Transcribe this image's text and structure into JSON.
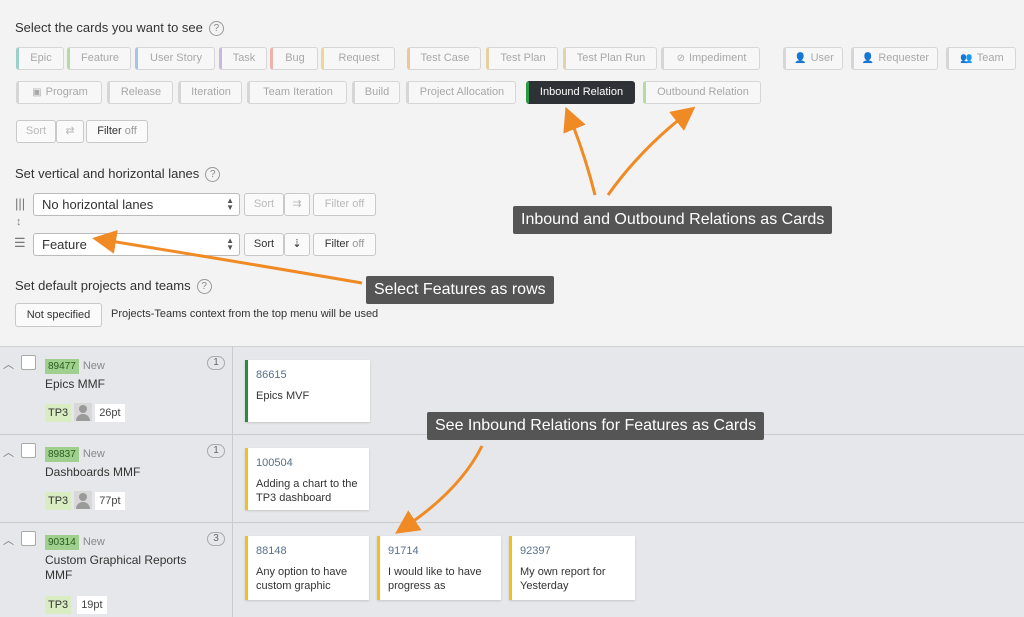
{
  "sections": {
    "cards_heading": "Select the cards you want to see",
    "lanes_heading": "Set vertical and horizontal lanes",
    "projects_heading": "Set default projects and teams",
    "help": "?"
  },
  "card_types_row1": [
    {
      "label": "Epic",
      "color": "#9bd0c8"
    },
    {
      "label": "Feature",
      "color": "#b6d9a7"
    },
    {
      "label": "User Story",
      "color": "#a9c3e6"
    },
    {
      "label": "Task",
      "color": "#c9b7df"
    },
    {
      "label": "Bug",
      "color": "#efb0b0"
    },
    {
      "label": "Request",
      "color": "#f1d49a"
    },
    {
      "label": "Test Case",
      "color": "#f1c59a"
    },
    {
      "label": "Test Plan",
      "color": "#e8d09e"
    },
    {
      "label": "Test Plan Run",
      "color": "#e1d2b3"
    },
    {
      "label": "Impediment",
      "color": "#d6d6d6"
    },
    {
      "label": "User",
      "color": "#d6d6d6"
    },
    {
      "label": "Requester",
      "color": "#d6d6d6"
    },
    {
      "label": "Team",
      "color": "#d6d6d6"
    }
  ],
  "card_types_row2": [
    {
      "label": "Program",
      "color": "#d6d6d6"
    },
    {
      "label": "Release",
      "color": "#d6d6d6"
    },
    {
      "label": "Iteration",
      "color": "#d6d6d6"
    },
    {
      "label": "Team Iteration",
      "color": "#d6d6d6"
    },
    {
      "label": "Build",
      "color": "#d6d6d6"
    },
    {
      "label": "Project Allocation",
      "color": "#d6d6d6"
    },
    {
      "label": "Inbound Relation",
      "color": "#2b9a44"
    },
    {
      "label": "Outbound Relation",
      "color": "#b6d9a7"
    }
  ],
  "cards_controls": {
    "sort": "Sort",
    "filter": "Filter",
    "filter_state": "off"
  },
  "lanes": {
    "horizontal_value": "No horizontal lanes",
    "vertical_value": "Feature",
    "sort": "Sort",
    "filter": "Filter",
    "filter_state": "off"
  },
  "projects": {
    "button": "Not specified",
    "note": "Projects-Teams context from the top menu will be used"
  },
  "callouts": {
    "relations": "Inbound and Outbound Relations as Cards",
    "features_rows": "Select Features as rows",
    "inbound_cards": "See Inbound Relations for Features as Cards"
  },
  "rows": [
    {
      "id": "89477",
      "state": "New",
      "title": "Epics MMF",
      "count": "1",
      "tag": "TP3",
      "has_avatar": true,
      "points": "26pt",
      "cards": [
        {
          "id": "86615",
          "text": "Epics MVF",
          "color": "#2b8a3e"
        }
      ]
    },
    {
      "id": "89837",
      "state": "New",
      "title": "Dashboards MMF",
      "count": "1",
      "tag": "TP3",
      "has_avatar": true,
      "points": "77pt",
      "cards": [
        {
          "id": "100504",
          "text": "Adding a chart to the TP3 dashboard",
          "color": "#f5bd1f"
        }
      ]
    },
    {
      "id": "90314",
      "state": "New",
      "title": "Custom Graphical Reports MMF",
      "count": "3",
      "tag": "TP3",
      "has_avatar": false,
      "points": "19pt",
      "cards": [
        {
          "id": "88148",
          "text": "Any option to have custom graphic",
          "color": "#f5bd1f"
        },
        {
          "id": "91714",
          "text": "I would like to have progress as",
          "color": "#f5bd1f"
        },
        {
          "id": "92397",
          "text": "My own report for Yesterday",
          "color": "#f5bd1f"
        }
      ]
    }
  ],
  "colors": {
    "accent_arrow": "#f08a24",
    "active_chip": "#2e3236"
  }
}
